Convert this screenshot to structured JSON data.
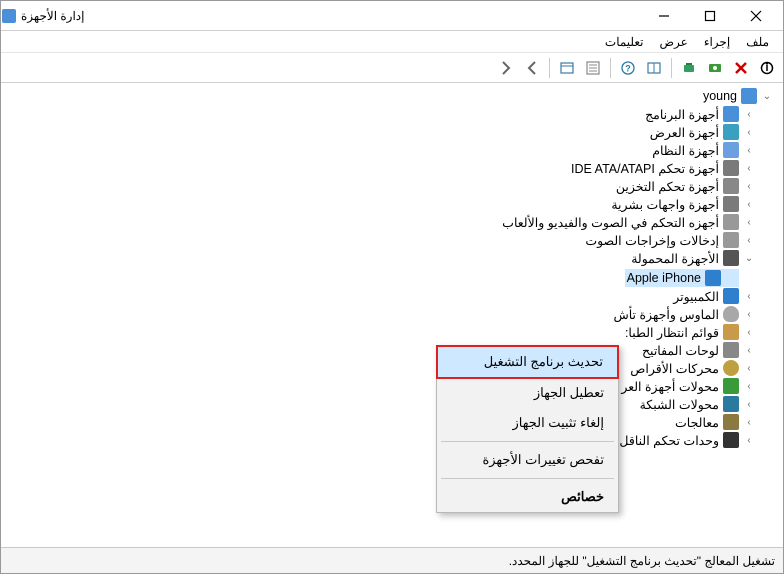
{
  "window": {
    "title": "إدارة الأجهزة"
  },
  "menubar": {
    "file": "ملف",
    "action": "إجراء",
    "view": "عرض",
    "help": "تعليمات"
  },
  "tree": {
    "root": "young",
    "items": [
      {
        "label": "أجهزة البرنامج",
        "icon": "c-pc"
      },
      {
        "label": "أجهزة العرض",
        "icon": "c-disp"
      },
      {
        "label": "أجهزة النظام",
        "icon": "c-sys"
      },
      {
        "label": "أجهزة تحكم IDE ATA/ATAPI",
        "icon": "c-ide"
      },
      {
        "label": "أجهزة تحكم التخزين",
        "icon": "c-stor"
      },
      {
        "label": "أجهزة واجهات بشرية",
        "icon": "c-hid"
      },
      {
        "label": "أجهزه التحكم في الصوت والفيديو والألعاب",
        "icon": "c-snd"
      },
      {
        "label": "إدخالات وإخراجات الصوت",
        "icon": "c-aud"
      },
      {
        "label": "الأجهزة المحمولة",
        "icon": "c-port",
        "expanded": true,
        "children": [
          {
            "label": "Apple iPhone",
            "icon": "c-sel",
            "selected": true
          }
        ]
      },
      {
        "label": "الكمبيوتر",
        "icon": "c-comp"
      },
      {
        "label": "الماوس وأجهزة تأش",
        "icon": "c-mouse",
        "truncated": true
      },
      {
        "label": "قوائم انتظار الطبا:",
        "icon": "c-prn",
        "truncated": true
      },
      {
        "label": "لوحات المفاتيح",
        "icon": "c-kbd"
      },
      {
        "label": "محركات الأقراص",
        "icon": "c-dvd"
      },
      {
        "label": "محولات أجهزة العر",
        "icon": "c-gpu",
        "truncated": true
      },
      {
        "label": "محولات الشبكة",
        "icon": "c-net"
      },
      {
        "label": "معالجات",
        "icon": "c-cpu"
      },
      {
        "label": "وحدات تحكم الناقل التسلسلي العالمي \"USB\"",
        "icon": "c-usb"
      }
    ]
  },
  "context_menu": {
    "update": "تحديث برنامج التشغيل",
    "disable": "تعطيل الجهاز",
    "uninstall": "إلغاء تثبيت الجهاز",
    "scan": "تفحص تغييرات الأجهزة",
    "props": "خصائص"
  },
  "statusbar": {
    "text": "تشغيل المعالج \"تحديث برنامج التشغيل\" للجهاز المحدد."
  }
}
